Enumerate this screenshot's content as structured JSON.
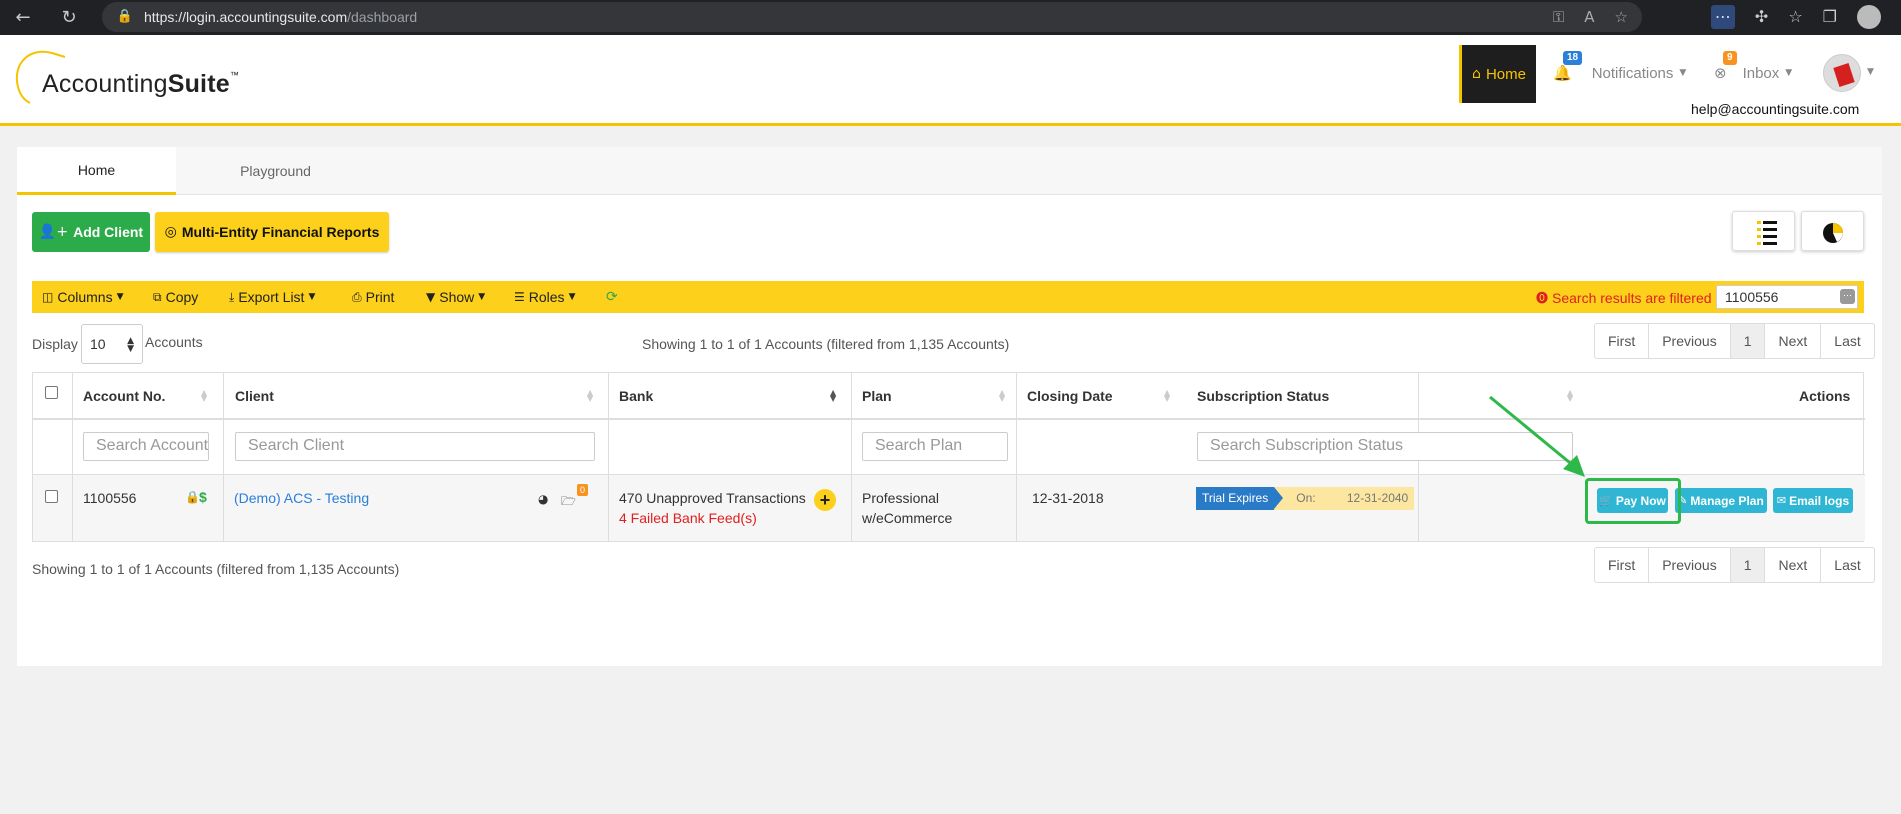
{
  "browser": {
    "url_host": "https://login.accountingsuite.com",
    "url_path": "/dashboard"
  },
  "header": {
    "logo_text_light": "Accounting",
    "logo_text_bold": "Suite",
    "logo_tm": "™",
    "home_label": "Home",
    "notifications_label": "Notifications",
    "notifications_count": "18",
    "inbox_label": "Inbox",
    "inbox_count": "9",
    "help_email": "help@accountingsuite.com"
  },
  "tabs": [
    {
      "label": "Home"
    },
    {
      "label": "Playground"
    }
  ],
  "buttons": {
    "add_client": "Add Client",
    "multi_entity": "Multi-Entity Financial Reports"
  },
  "toolbar": {
    "columns": "Columns",
    "copy": "Copy",
    "export": "Export List",
    "print": "Print",
    "show": "Show",
    "roles": "Roles",
    "filter_note": "Search results are filtered",
    "filter_value": "1100556"
  },
  "display": {
    "label": "Display",
    "value": "10",
    "suffix": "Accounts"
  },
  "showing_text": "Showing 1 to 1 of 1 Accounts (filtered from 1,135 Accounts)",
  "pager": {
    "first": "First",
    "previous": "Previous",
    "current": "1",
    "next": "Next",
    "last": "Last"
  },
  "table": {
    "headers": {
      "account_no": "Account No.",
      "client": "Client",
      "bank": "Bank",
      "plan": "Plan",
      "closing_date": "Closing Date",
      "subscription_status": "Subscription Status",
      "actions": "Actions"
    },
    "search_placeholders": {
      "account": "Search Account",
      "client": "Search Client",
      "plan": "Search Plan",
      "subscription": "Search Subscription Status"
    },
    "row": {
      "account_no": "1100556",
      "client": "(Demo) ACS - Testing",
      "client_badge": "0",
      "bank_line1": "470 Unapproved Transactions",
      "bank_line2": "4 Failed Bank Feed(s)",
      "plan_line1": "Professional",
      "plan_line2": "w/eCommerce",
      "closing_date": "12-31-2018",
      "status_tag": "Trial Expires",
      "status_on": "On:",
      "status_date": "12-31-2040",
      "pay_now": "Pay Now",
      "manage_plan": "Manage Plan",
      "email_logs": "Email logs"
    }
  },
  "colors": {
    "brand_yellow": "#fcd01b",
    "green": "#2bab49",
    "action_blue": "#2fb6d5",
    "link_blue": "#2a7fd8",
    "error_red": "#e02020"
  }
}
